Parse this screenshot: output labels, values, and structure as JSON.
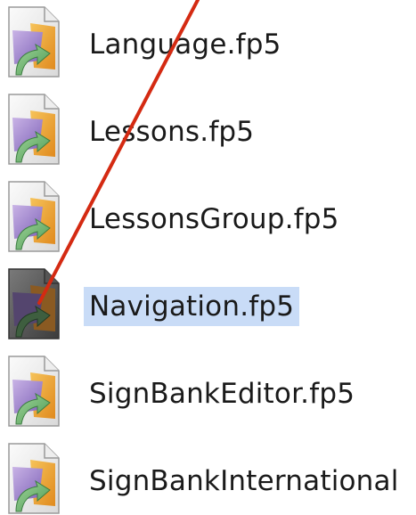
{
  "files": [
    {
      "name": "Language.fp5",
      "icon": "filemaker-document-icon",
      "selected": false
    },
    {
      "name": "Lessons.fp5",
      "icon": "filemaker-document-icon",
      "selected": false
    },
    {
      "name": "LessonsGroup.fp5",
      "icon": "filemaker-document-icon",
      "selected": false
    },
    {
      "name": "Navigation.fp5",
      "icon": "filemaker-document-icon",
      "selected": true
    },
    {
      "name": "SignBankEditor.fp5",
      "icon": "filemaker-document-icon",
      "selected": false
    },
    {
      "name": "SignBankInternational",
      "icon": "filemaker-document-icon",
      "selected": false
    }
  ],
  "colors": {
    "selection_highlight": "#c9dcf7",
    "annotation_line": "#d42a12"
  }
}
